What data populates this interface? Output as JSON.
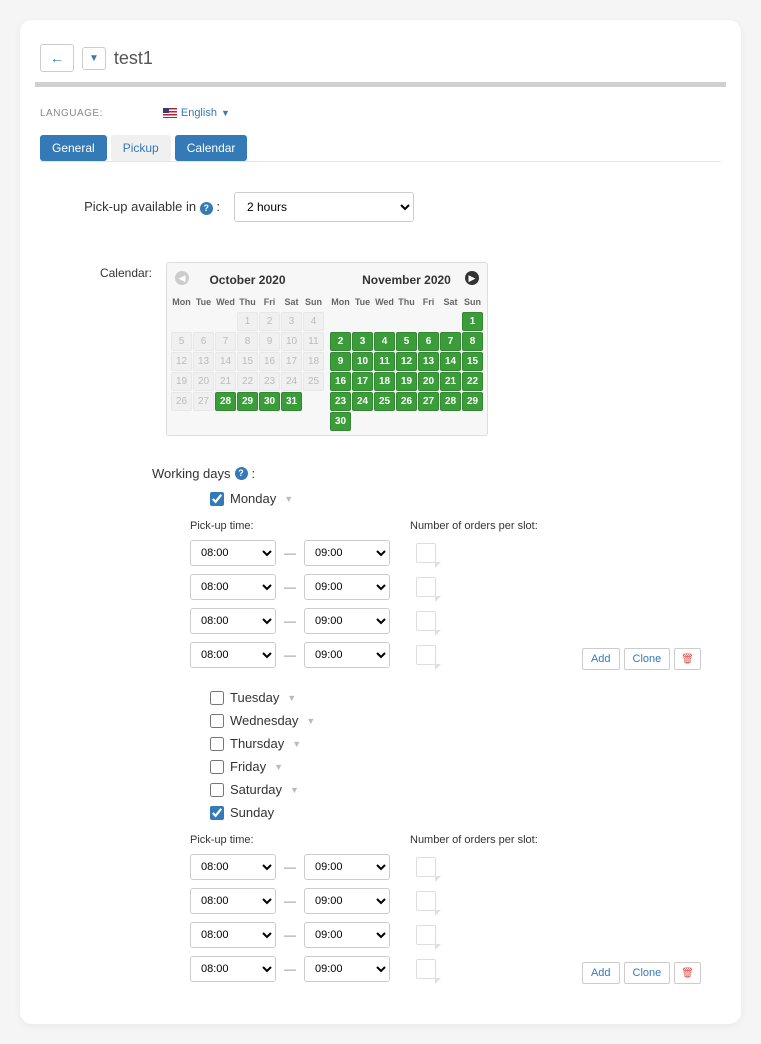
{
  "header": {
    "title": "test1"
  },
  "language": {
    "label": "LANGUAGE:",
    "value": "English"
  },
  "tabs": {
    "general": "General",
    "pickup": "Pickup",
    "calendar": "Calendar"
  },
  "pickup_available": {
    "label": "Pick-up available in",
    "value": "2 hours"
  },
  "calendar": {
    "label": "Calendar:",
    "month1_title": "October 2020",
    "month2_title": "November 2020",
    "day_headers": [
      "Mon",
      "Tue",
      "Wed",
      "Thu",
      "Fri",
      "Sat",
      "Sun"
    ],
    "month1_blanks": 3,
    "month1_days": [
      {
        "n": 1,
        "s": "inactive"
      },
      {
        "n": 2,
        "s": "inactive"
      },
      {
        "n": 3,
        "s": "inactive"
      },
      {
        "n": 4,
        "s": "inactive"
      },
      {
        "n": 5,
        "s": "inactive"
      },
      {
        "n": 6,
        "s": "inactive"
      },
      {
        "n": 7,
        "s": "inactive"
      },
      {
        "n": 8,
        "s": "inactive"
      },
      {
        "n": 9,
        "s": "inactive"
      },
      {
        "n": 10,
        "s": "inactive"
      },
      {
        "n": 11,
        "s": "inactive"
      },
      {
        "n": 12,
        "s": "inactive"
      },
      {
        "n": 13,
        "s": "inactive"
      },
      {
        "n": 14,
        "s": "inactive"
      },
      {
        "n": 15,
        "s": "inactive"
      },
      {
        "n": 16,
        "s": "inactive"
      },
      {
        "n": 17,
        "s": "inactive"
      },
      {
        "n": 18,
        "s": "inactive"
      },
      {
        "n": 19,
        "s": "inactive"
      },
      {
        "n": 20,
        "s": "inactive"
      },
      {
        "n": 21,
        "s": "inactive"
      },
      {
        "n": 22,
        "s": "inactive"
      },
      {
        "n": 23,
        "s": "inactive"
      },
      {
        "n": 24,
        "s": "inactive"
      },
      {
        "n": 25,
        "s": "inactive"
      },
      {
        "n": 26,
        "s": "inactive"
      },
      {
        "n": 27,
        "s": "inactive"
      },
      {
        "n": 28,
        "s": "active"
      },
      {
        "n": 29,
        "s": "active"
      },
      {
        "n": 30,
        "s": "active"
      },
      {
        "n": 31,
        "s": "active"
      }
    ],
    "month2_blanks": 6,
    "month2_days": [
      {
        "n": 1,
        "s": "active"
      },
      {
        "n": 2,
        "s": "active"
      },
      {
        "n": 3,
        "s": "active"
      },
      {
        "n": 4,
        "s": "active"
      },
      {
        "n": 5,
        "s": "active"
      },
      {
        "n": 6,
        "s": "active"
      },
      {
        "n": 7,
        "s": "active"
      },
      {
        "n": 8,
        "s": "active"
      },
      {
        "n": 9,
        "s": "active"
      },
      {
        "n": 10,
        "s": "active"
      },
      {
        "n": 11,
        "s": "active"
      },
      {
        "n": 12,
        "s": "active"
      },
      {
        "n": 13,
        "s": "active"
      },
      {
        "n": 14,
        "s": "active"
      },
      {
        "n": 15,
        "s": "active"
      },
      {
        "n": 16,
        "s": "active"
      },
      {
        "n": 17,
        "s": "active"
      },
      {
        "n": 18,
        "s": "active"
      },
      {
        "n": 19,
        "s": "active"
      },
      {
        "n": 20,
        "s": "active"
      },
      {
        "n": 21,
        "s": "active"
      },
      {
        "n": 22,
        "s": "active"
      },
      {
        "n": 23,
        "s": "active"
      },
      {
        "n": 24,
        "s": "active"
      },
      {
        "n": 25,
        "s": "active"
      },
      {
        "n": 26,
        "s": "active"
      },
      {
        "n": 27,
        "s": "active"
      },
      {
        "n": 28,
        "s": "active"
      },
      {
        "n": 29,
        "s": "active"
      },
      {
        "n": 30,
        "s": "active"
      }
    ]
  },
  "working_days": {
    "label": "Working days",
    "pickup_time_label": "Pick-up time:",
    "orders_label": "Number of orders per slot:",
    "days": {
      "monday": "Monday",
      "tuesday": "Tuesday",
      "wednesday": "Wednesday",
      "thursday": "Thursday",
      "friday": "Friday",
      "saturday": "Saturday",
      "sunday": "Sunday"
    },
    "time_from": "08:00",
    "time_to": "09:00"
  },
  "actions": {
    "add": "Add",
    "clone": "Clone"
  }
}
